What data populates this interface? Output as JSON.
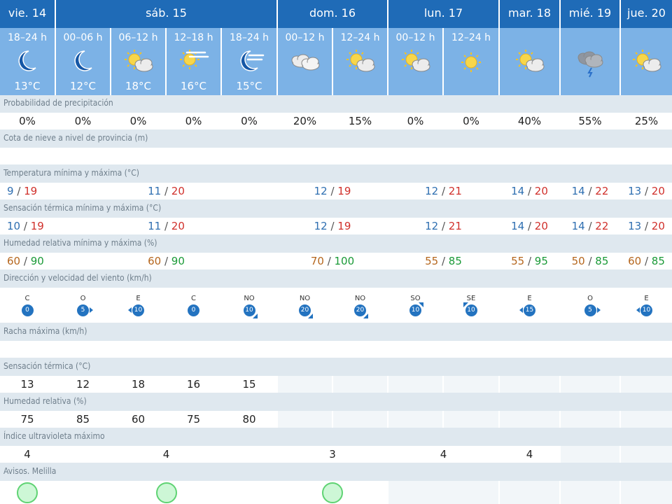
{
  "days": [
    {
      "label": "vie. 14"
    },
    {
      "label": "sáb. 15"
    },
    {
      "label": "dom. 16"
    },
    {
      "label": "lun. 17"
    },
    {
      "label": "mar. 18"
    },
    {
      "label": "mié. 19"
    },
    {
      "label": "jue. 20"
    }
  ],
  "slots": [
    {
      "time": "18–24 h",
      "icon": "moon-icon",
      "temp": "13°C"
    },
    {
      "time": "00–06 h",
      "icon": "moon-icon",
      "temp": "12°C"
    },
    {
      "time": "06–12 h",
      "icon": "sun-cloud-icon",
      "temp": "18°C"
    },
    {
      "time": "12–18 h",
      "icon": "sun-haze-icon",
      "temp": "16°C"
    },
    {
      "time": "18–24 h",
      "icon": "moon-haze-icon",
      "temp": "15°C"
    },
    {
      "time": "00–12 h",
      "icon": "cloud-icon",
      "temp": ""
    },
    {
      "time": "12–24 h",
      "icon": "sun-cloud-icon",
      "temp": ""
    },
    {
      "time": "00–12 h",
      "icon": "sun-cloud-icon",
      "temp": ""
    },
    {
      "time": "12–24 h",
      "icon": "sun-icon",
      "temp": ""
    },
    {
      "time": "",
      "icon": "sun-cloud-icon",
      "temp": ""
    },
    {
      "time": "",
      "icon": "storm-cloud-icon",
      "temp": ""
    },
    {
      "time": "",
      "icon": "sun-cloud-icon",
      "temp": ""
    }
  ],
  "labels": {
    "precip": "Probabilidad de precipitación",
    "snow": "Cota de nieve a nivel de provincia (m)",
    "temp": "Temperatura mínima y máxima (°C)",
    "feels": "Sensación térmica mínima y máxima (°C)",
    "hum": "Humedad relativa mínima y máxima (%)",
    "wind": "Dirección y velocidad del viento (km/h)",
    "gust": "Racha máxima (km/h)",
    "feels_t": "Sensación térmica (°C)",
    "hum_r": "Humedad relativa (%)",
    "uv": "Índice ultravioleta máximo",
    "warn": "Avisos. Melilla"
  },
  "precip": [
    "0%",
    "0%",
    "0%",
    "0%",
    "0%",
    "20%",
    "15%",
    "0%",
    "0%",
    "40%",
    "55%",
    "25%"
  ],
  "temp": [
    [
      "9",
      "19"
    ],
    [
      "11",
      "20"
    ],
    [
      "12",
      "19"
    ],
    [
      "12",
      "21"
    ],
    [
      "14",
      "20"
    ],
    [
      "14",
      "22"
    ],
    [
      "13",
      "20"
    ]
  ],
  "feels": [
    [
      "10",
      "19"
    ],
    [
      "11",
      "20"
    ],
    [
      "12",
      "19"
    ],
    [
      "12",
      "21"
    ],
    [
      "14",
      "20"
    ],
    [
      "14",
      "22"
    ],
    [
      "13",
      "20"
    ]
  ],
  "hum": [
    [
      "60",
      "90"
    ],
    [
      "60",
      "90"
    ],
    [
      "70",
      "100"
    ],
    [
      "55",
      "85"
    ],
    [
      "55",
      "95"
    ],
    [
      "50",
      "85"
    ],
    [
      "60",
      "85"
    ]
  ],
  "wind": [
    {
      "dir": "C",
      "speed": "0",
      "from": ""
    },
    {
      "dir": "O",
      "speed": "5",
      "from": "O"
    },
    {
      "dir": "E",
      "speed": "10",
      "from": "E"
    },
    {
      "dir": "C",
      "speed": "0",
      "from": ""
    },
    {
      "dir": "NO",
      "speed": "10",
      "from": "NO"
    },
    {
      "dir": "NO",
      "speed": "20",
      "from": "NO"
    },
    {
      "dir": "NO",
      "speed": "20",
      "from": "NO"
    },
    {
      "dir": "SO",
      "speed": "10",
      "from": "SO"
    },
    {
      "dir": "SE",
      "speed": "10",
      "from": "SE"
    },
    {
      "dir": "E",
      "speed": "15",
      "from": "E"
    },
    {
      "dir": "O",
      "speed": "5",
      "from": "O"
    },
    {
      "dir": "E",
      "speed": "10",
      "from": "E"
    }
  ],
  "feels_t": [
    "13",
    "12",
    "18",
    "16",
    "15"
  ],
  "hum_r": [
    "75",
    "85",
    "60",
    "75",
    "80"
  ],
  "uv": [
    "4",
    "4",
    "3",
    "4",
    "4",
    "",
    ""
  ],
  "warn": [
    true,
    true,
    true,
    false,
    false,
    false,
    false
  ],
  "colors": {
    "header": "#1f6bb7",
    "slot": "#7cb2e6",
    "bg": "#dfe8ef",
    "low": "#2f6fb1",
    "high": "#d0302b",
    "hum_low": "#b5661d",
    "hum_high": "#1a9a37",
    "wind_badge": "#2373c0",
    "uv": "#e0c600",
    "warn": "#5fd373"
  }
}
